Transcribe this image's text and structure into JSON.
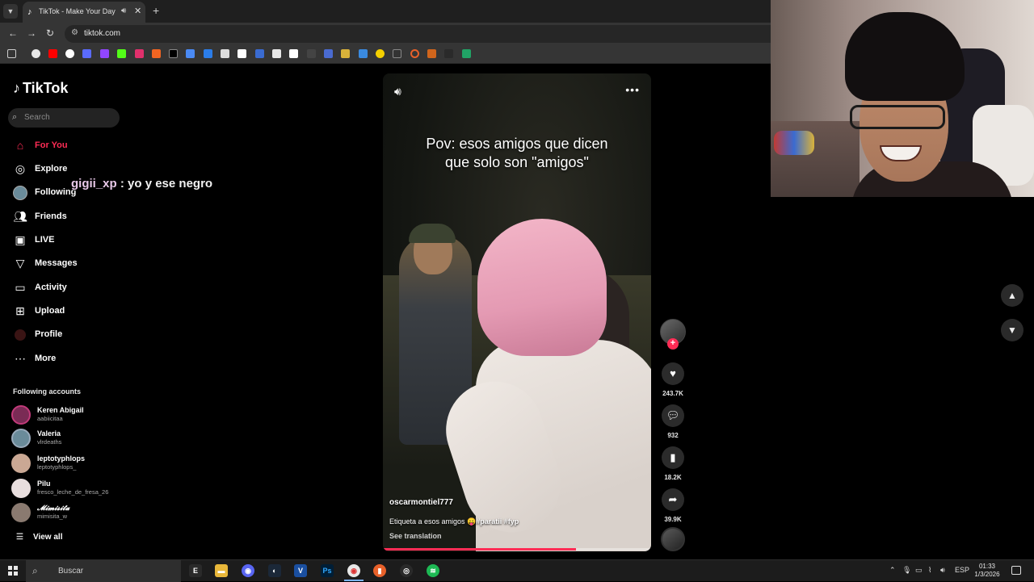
{
  "browser": {
    "tab_title": "TikTok - Make Your Day",
    "url": "tiktok.com",
    "new_tab_symbol": "+"
  },
  "sidebar": {
    "logo": "TikTok",
    "search_placeholder": "Search",
    "nav": [
      {
        "label": "For You",
        "icon": "home-icon",
        "active": true
      },
      {
        "label": "Explore",
        "icon": "compass-icon"
      },
      {
        "label": "Following",
        "icon": "following-avatar-icon"
      },
      {
        "label": "Friends",
        "icon": "friends-icon"
      },
      {
        "label": "LIVE",
        "icon": "live-icon"
      },
      {
        "label": "Messages",
        "icon": "messages-icon"
      },
      {
        "label": "Activity",
        "icon": "activity-icon"
      },
      {
        "label": "Upload",
        "icon": "upload-icon"
      },
      {
        "label": "Profile",
        "icon": "profile-avatar-icon"
      },
      {
        "label": "More",
        "icon": "more-dots-icon"
      }
    ],
    "following_title": "Following accounts",
    "accounts": [
      {
        "name": "Keren Abigail",
        "handle": "aabiicitaa",
        "color": "#7a2b55"
      },
      {
        "name": "Valeria",
        "handle": "vlrdeaths",
        "color": "#6a8b9a"
      },
      {
        "name": "leptotyphlops",
        "handle": "leptotyphlops_",
        "color": "#caa894"
      },
      {
        "name": "Pilu",
        "handle": "fresco_leche_de_fresa_26",
        "color": "#e8dede"
      },
      {
        "name": "𝓜𝓲𝓶𝓲𝓼𝓲𝓽𝓪",
        "handle": "mimisita_w",
        "color": "#8a7a70"
      }
    ],
    "view_all": "View all"
  },
  "chat_overlay": {
    "user": "gigii_xp",
    "separator": " : ",
    "message": "yo y ese negro"
  },
  "video": {
    "caption_line1": "Pov: esos amigos que dicen",
    "caption_line2": "que solo son \"amigos\"",
    "author": "oscarmontiel777",
    "description": "Etiqueta a esos amigos 😛",
    "hashtags": "#paratii #fyp",
    "see_translation": "See translation",
    "progress": 0.72
  },
  "actions": {
    "likes": "243.7K",
    "comments": "932",
    "saves": "18.2K",
    "shares": "39.9K"
  },
  "taskbar": {
    "search_placeholder": "Buscar",
    "language": "ESP",
    "time": "01:33",
    "date": "1/3/2026"
  }
}
